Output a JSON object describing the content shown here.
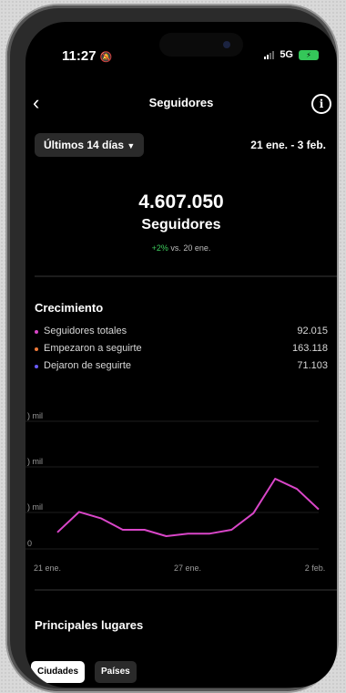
{
  "status": {
    "time": "11:27",
    "network": "5G",
    "silent_icon": "bell-slash-icon",
    "battery_icon": "battery-charging-icon"
  },
  "nav": {
    "title": "Seguidores",
    "back_icon": "chevron-left-icon",
    "info_icon": "info-icon"
  },
  "filter": {
    "range_label": "Últimos 14 días",
    "dropdown_icon": "chevron-down-icon",
    "date_range": "21 ene. - 3 feb."
  },
  "summary": {
    "total": "4.607.050",
    "label": "Seguidores",
    "delta_pct": "+2%",
    "delta_suffix": "vs. 20 ene."
  },
  "growth": {
    "title": "Crecimiento",
    "legend": [
      {
        "name": "Seguidores totales",
        "value": "92.015",
        "color": "#d946c8"
      },
      {
        "name": "Empezaron a seguirte",
        "value": "163.118",
        "color": "#f07a3a"
      },
      {
        "name": "Dejaron de seguirte",
        "value": "71.103",
        "color": "#6a5cff"
      }
    ]
  },
  "chart_data": {
    "type": "line",
    "x_tick_labels": [
      "21 ene.",
      "27 ene.",
      "2 feb."
    ],
    "y_tick_labels": [
      ") mil",
      ") mil",
      ") mil",
      "0"
    ],
    "series": [
      {
        "name": "Seguidores totales",
        "color": "#d946c8",
        "values": [
          0.13,
          0.29,
          0.24,
          0.15,
          0.15,
          0.1,
          0.12,
          0.12,
          0.15,
          0.28,
          0.55,
          0.47,
          0.31
        ]
      }
    ],
    "ylim": [
      0,
      1
    ]
  },
  "places": {
    "title": "Principales lugares",
    "tabs": [
      "Ciudades",
      "Países"
    ],
    "active_tab": 0
  },
  "colors": {
    "positive": "#3ecf5e",
    "line": "#d946c8"
  }
}
